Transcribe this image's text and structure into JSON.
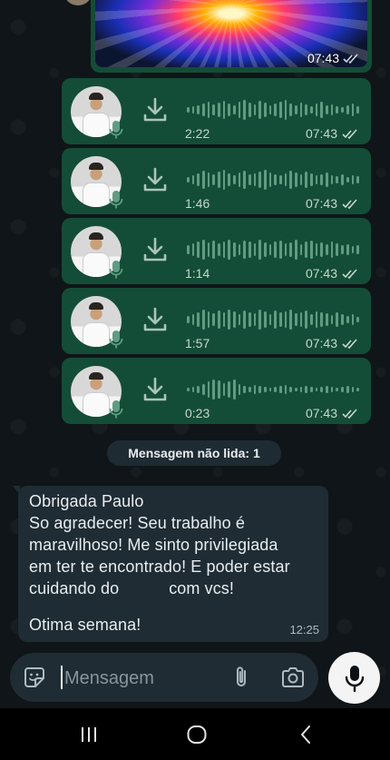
{
  "image_message": {
    "time": "07:43"
  },
  "audio_messages": [
    {
      "duration": "2:22",
      "time": "07:43"
    },
    {
      "duration": "1:46",
      "time": "07:43"
    },
    {
      "duration": "1:14",
      "time": "07:43"
    },
    {
      "duration": "1:57",
      "time": "07:43"
    },
    {
      "duration": "0:23",
      "time": "07:43"
    }
  ],
  "unread_label": "Mensagem não lida: 1",
  "incoming_message": {
    "lines": [
      "Obrigada Paulo",
      "So agradecer! Seu trabalho é",
      "maravilhoso! Me sinto privilegiada",
      "em ter te encontrado! E poder estar",
      "cuidando do",
      "com vcs!",
      "",
      "Otima semana!"
    ],
    "time": "12:25"
  },
  "composer": {
    "placeholder": "Mensagem"
  },
  "icons": {
    "download": "download-icon",
    "mic_badge": "microphone-icon",
    "read_ticks": "double-check-icon",
    "emoji": "sticker-icon",
    "attach": "paperclip-icon",
    "camera": "camera-icon",
    "send_audio": "microphone-icon",
    "nav_recents": "recents-icon",
    "nav_home": "home-icon",
    "nav_back": "back-icon"
  },
  "colors": {
    "outgoing_bubble": "#144d37",
    "incoming_bubble": "#1f2c33",
    "background": "#0f1518",
    "read_tick": "#c7d7cf"
  }
}
